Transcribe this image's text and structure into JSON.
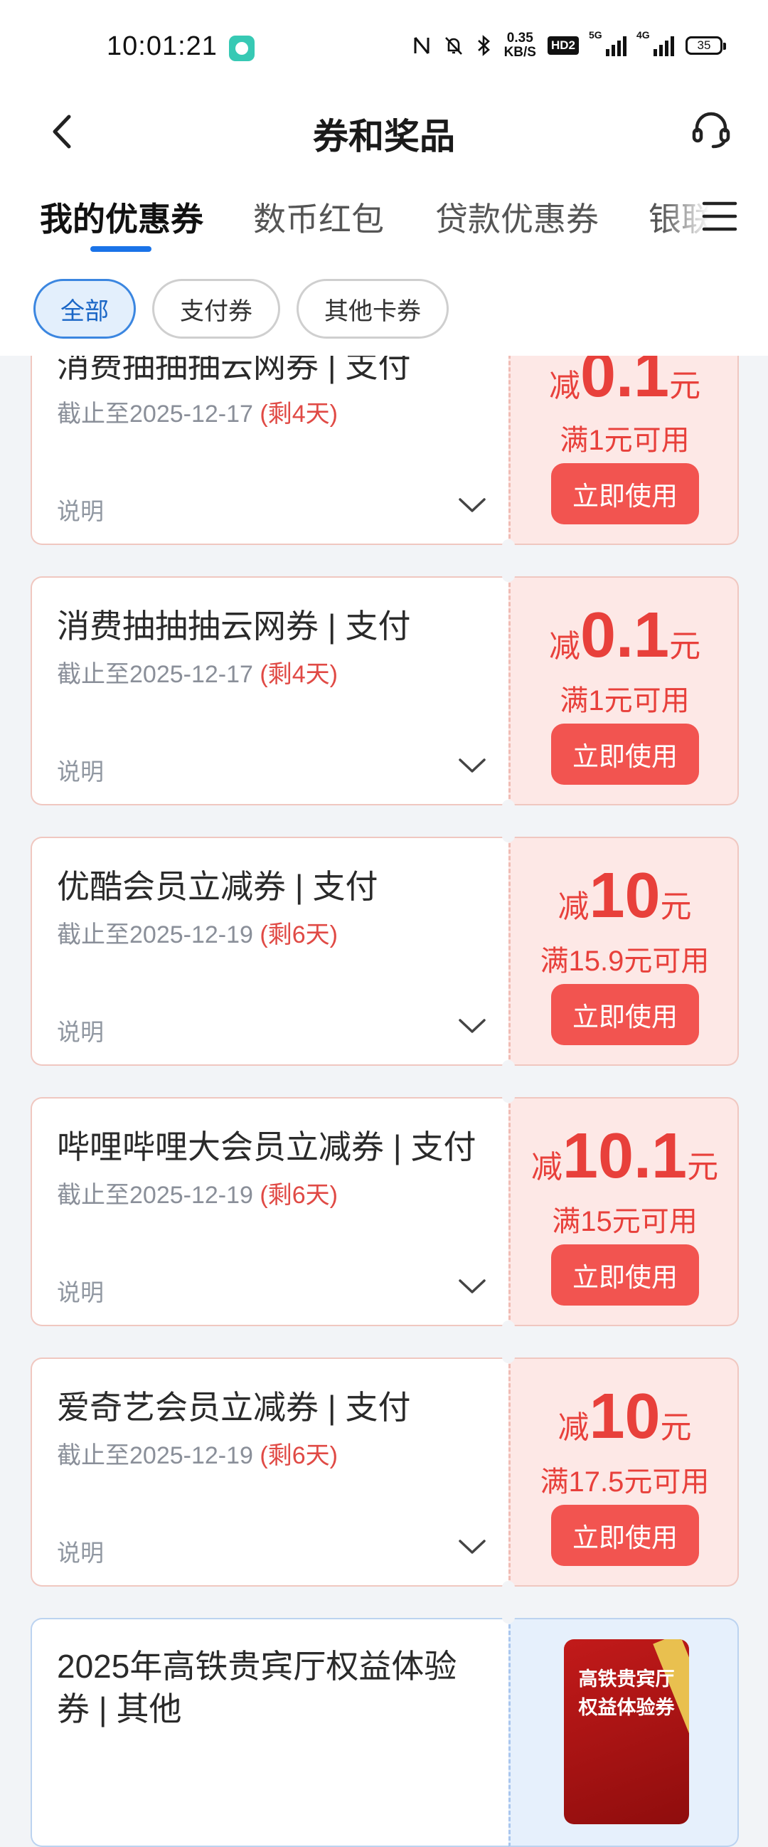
{
  "status_bar": {
    "time": "10:01:21",
    "net_speed_value": "0.35",
    "net_speed_unit": "KB/S",
    "hd_label": "HD2",
    "signal_5g": "5G",
    "signal_4g": "4G",
    "battery": "35"
  },
  "nav": {
    "title": "券和奖品"
  },
  "tabs": [
    "我的优惠券",
    "数币红包",
    "贷款优惠券",
    "银联"
  ],
  "filters": [
    "全部",
    "支付券",
    "其他卡券"
  ],
  "coupons": [
    {
      "title": "消费抽抽抽云网券 | 支付",
      "deadline": "截止至2025-12-17",
      "remaining": "(剩4天)",
      "desc_label": "说明",
      "prefix": "减",
      "amount": "0.1",
      "unit": "元",
      "condition": "满1元可用",
      "button": "立即使用"
    },
    {
      "title": "消费抽抽抽云网券 | 支付",
      "deadline": "截止至2025-12-17",
      "remaining": "(剩4天)",
      "desc_label": "说明",
      "prefix": "减",
      "amount": "0.1",
      "unit": "元",
      "condition": "满1元可用",
      "button": "立即使用"
    },
    {
      "title": "优酷会员立减券 | 支付",
      "deadline": "截止至2025-12-19",
      "remaining": "(剩6天)",
      "desc_label": "说明",
      "prefix": "减",
      "amount": "10",
      "unit": "元",
      "condition": "满15.9元可用",
      "button": "立即使用"
    },
    {
      "title": "哔哩哔哩大会员立减券 | 支付",
      "deadline": "截止至2025-12-19",
      "remaining": "(剩6天)",
      "desc_label": "说明",
      "prefix": "减",
      "amount": "10.1",
      "unit": "元",
      "condition": "满15元可用",
      "button": "立即使用"
    },
    {
      "title": "爱奇艺会员立减券 | 支付",
      "deadline": "截止至2025-12-19",
      "remaining": "(剩6天)",
      "desc_label": "说明",
      "prefix": "减",
      "amount": "10",
      "unit": "元",
      "condition": "满17.5元可用",
      "button": "立即使用"
    }
  ],
  "hsr_coupon": {
    "title_line1": "2025年高铁贵宾厅权益体验",
    "title_line2": "券 | 其他",
    "image_text_line1": "高铁贵宾厅",
    "image_text_line2": "权益体验券"
  },
  "colors": {
    "accent_blue": "#1a73e8",
    "coupon_red": "#e8403b",
    "button_red": "#f25450",
    "coupon_right_bg": "#fde8e6"
  }
}
